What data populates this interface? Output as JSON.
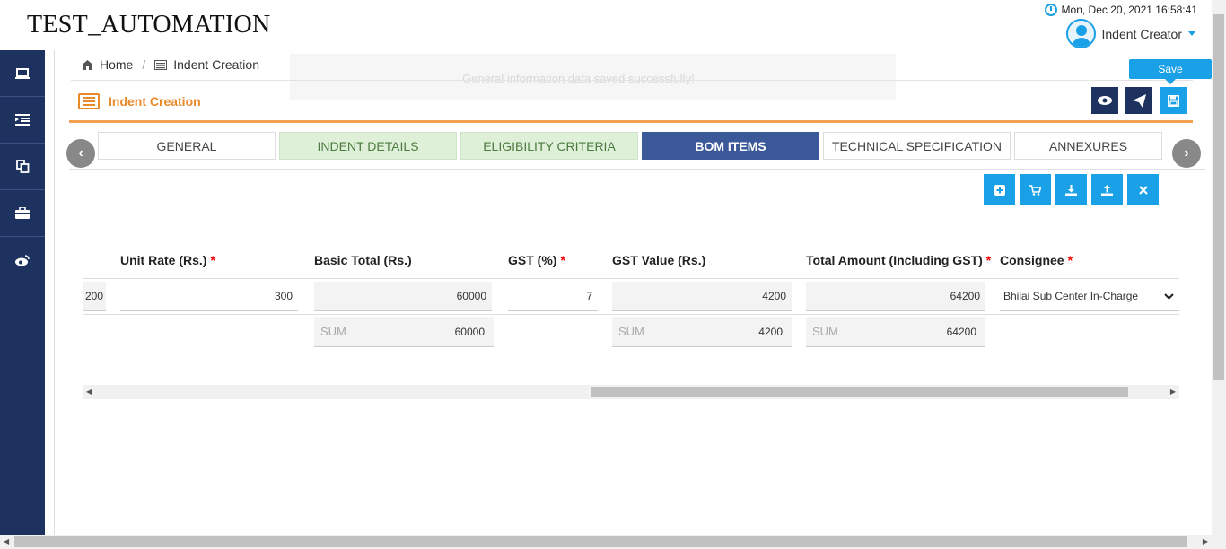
{
  "app": {
    "title": "TEST_AUTOMATION"
  },
  "header": {
    "datetime": "Mon, Dec 20, 2021 16:58:41",
    "user_name": "Indent Creator"
  },
  "sidebar": {
    "items": [
      {
        "icon": "laptop-icon"
      },
      {
        "icon": "indent-list-icon"
      },
      {
        "icon": "copy-icon"
      },
      {
        "icon": "briefcase-icon"
      },
      {
        "icon": "weibo-icon"
      }
    ]
  },
  "breadcrumb": {
    "home": "Home",
    "current": "Indent Creation"
  },
  "toast": {
    "message": "General information data saved successfully!"
  },
  "page": {
    "title": "Indent Creation",
    "save_tooltip": "Save"
  },
  "tabs": [
    {
      "label": "GENERAL",
      "state": "default"
    },
    {
      "label": "INDENT DETAILS",
      "state": "completed"
    },
    {
      "label": "ELIGIBILITY CRITERIA",
      "state": "completed"
    },
    {
      "label": "BOM ITEMS",
      "state": "active"
    },
    {
      "label": "TECHNICAL SPECIFICATION",
      "state": "default"
    },
    {
      "label": "ANNEXURES",
      "state": "default"
    }
  ],
  "table": {
    "headers": {
      "unit_rate": "Unit Rate (Rs.)",
      "basic_total": "Basic Total (Rs.)",
      "gst_pct": "GST (%)",
      "gst_value": "GST Value (Rs.)",
      "total_amount": "Total Amount (Including GST)",
      "consignee": "Consignee"
    },
    "required_mark": "*",
    "row": {
      "quantity_partial": "200",
      "unit_rate": "300",
      "basic_total": "60000",
      "gst_pct": "7",
      "gst_value": "4200",
      "total_amount": "64200",
      "consignee": "Bhilai Sub Center In-Charge"
    },
    "sum_label": "SUM",
    "sums": {
      "basic_total": "60000",
      "gst_value": "4200",
      "total_amount": "64200"
    }
  },
  "colors": {
    "primary": "#1aa0e6",
    "navy": "#1e3260",
    "accent_orange": "#e8892a",
    "active_tab": "#3b5998",
    "completed_tab": "#dff0d8"
  }
}
